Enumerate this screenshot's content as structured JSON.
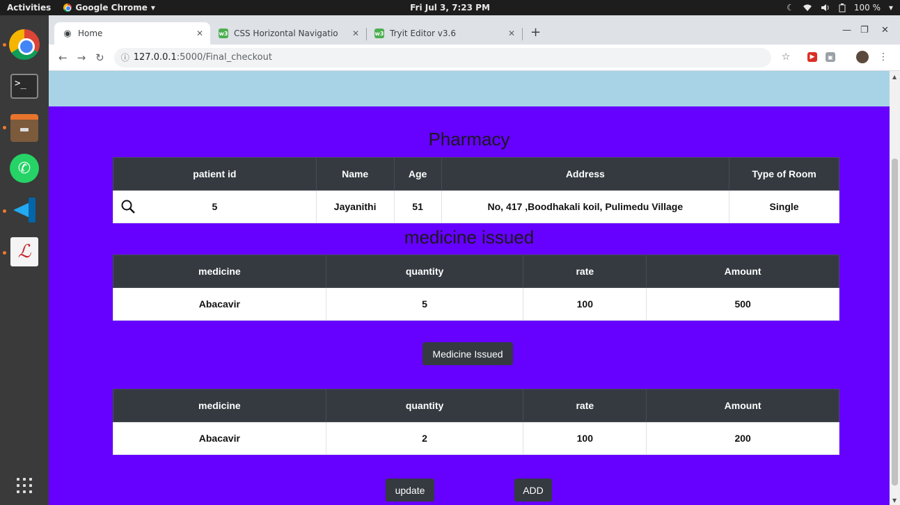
{
  "topbar": {
    "activities": "Activities",
    "app_name": "Google Chrome",
    "app_menu_arrow": "▾",
    "clock": "Fri Jul  3,  7:23 PM",
    "battery": "100 %"
  },
  "tabs": [
    {
      "title": "Home"
    },
    {
      "title": "CSS Horizontal Navigatio"
    },
    {
      "title": "Tryit Editor v3.6"
    }
  ],
  "favicon_w3": "w3",
  "address_bar": {
    "host": "127.0.0.1",
    "path": ":5000/Final_checkout"
  },
  "page": {
    "title": "Pharmacy",
    "patient_table": {
      "headers": [
        "patient id",
        "Name",
        "Age",
        "Address",
        "Type of Room"
      ],
      "row": [
        "5",
        "Jayanithi",
        "51",
        "No, 417 ,Boodhakali koil, Pulimedu Village",
        "Single"
      ]
    },
    "medicine_heading": "medicine issued",
    "issued_table": {
      "headers": [
        "medicine",
        "quantity",
        "rate",
        "Amount"
      ],
      "row": [
        "Abacavir",
        "5",
        "100",
        "500"
      ]
    },
    "medicine_issued_button": "Medicine Issued",
    "pending_table": {
      "headers": [
        "medicine",
        "quantity",
        "rate",
        "Amount"
      ],
      "row": [
        "Abacavir",
        "2",
        "100",
        "200"
      ]
    },
    "update_button": "update",
    "add_button": "ADD"
  },
  "colors": {
    "page_bg": "#6600ff",
    "header_band": "#a8d3e6",
    "table_head": "#343a40",
    "button": "#343a40"
  }
}
